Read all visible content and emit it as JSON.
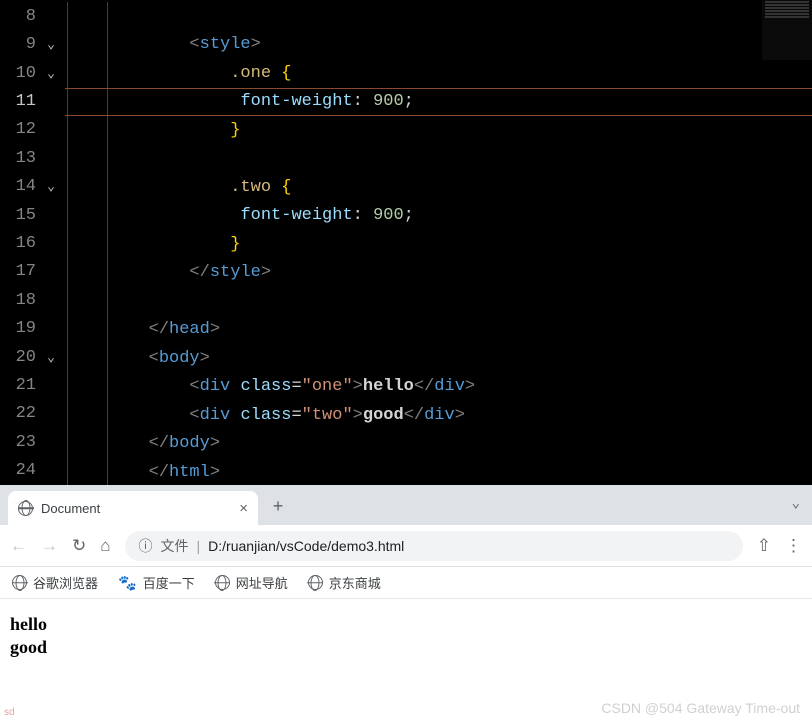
{
  "editor": {
    "highlighted_line": 11,
    "lines": [
      {
        "num": 8,
        "chevron": false,
        "indent": 0,
        "segments": []
      },
      {
        "num": 9,
        "chevron": true,
        "indent": 3,
        "segments": [
          {
            "cls": "tag-bracket",
            "t": "<"
          },
          {
            "cls": "tag-name",
            "t": "style"
          },
          {
            "cls": "tag-bracket",
            "t": ">"
          }
        ]
      },
      {
        "num": 10,
        "chevron": true,
        "indent": 4,
        "segments": [
          {
            "cls": "selector",
            "t": ".one"
          },
          {
            "cls": "",
            "t": " "
          },
          {
            "cls": "brace",
            "t": "{"
          }
        ]
      },
      {
        "num": 11,
        "chevron": false,
        "indent": 4,
        "segments": [
          {
            "cls": "",
            "t": " "
          },
          {
            "cls": "property",
            "t": "font-weight"
          },
          {
            "cls": "colon",
            "t": ": "
          },
          {
            "cls": "value-num",
            "t": "900"
          },
          {
            "cls": "semi",
            "t": ";"
          }
        ]
      },
      {
        "num": 12,
        "chevron": false,
        "indent": 4,
        "segments": [
          {
            "cls": "brace",
            "t": "}"
          }
        ]
      },
      {
        "num": 13,
        "chevron": false,
        "indent": 0,
        "segments": []
      },
      {
        "num": 14,
        "chevron": true,
        "indent": 4,
        "segments": [
          {
            "cls": "selector",
            "t": ".two"
          },
          {
            "cls": "",
            "t": " "
          },
          {
            "cls": "brace",
            "t": "{"
          }
        ]
      },
      {
        "num": 15,
        "chevron": false,
        "indent": 4,
        "segments": [
          {
            "cls": "",
            "t": " "
          },
          {
            "cls": "property",
            "t": "font-weight"
          },
          {
            "cls": "colon",
            "t": ": "
          },
          {
            "cls": "value-num",
            "t": "900"
          },
          {
            "cls": "semi",
            "t": ";"
          }
        ]
      },
      {
        "num": 16,
        "chevron": false,
        "indent": 4,
        "segments": [
          {
            "cls": "brace",
            "t": "}"
          }
        ]
      },
      {
        "num": 17,
        "chevron": false,
        "indent": 3,
        "segments": [
          {
            "cls": "tag-bracket",
            "t": "</"
          },
          {
            "cls": "tag-name",
            "t": "style"
          },
          {
            "cls": "tag-bracket",
            "t": ">"
          }
        ]
      },
      {
        "num": 18,
        "chevron": false,
        "indent": 0,
        "segments": []
      },
      {
        "num": 19,
        "chevron": false,
        "indent": 2,
        "segments": [
          {
            "cls": "tag-bracket",
            "t": "</"
          },
          {
            "cls": "tag-name",
            "t": "head"
          },
          {
            "cls": "tag-bracket",
            "t": ">"
          }
        ]
      },
      {
        "num": 20,
        "chevron": true,
        "indent": 2,
        "segments": [
          {
            "cls": "tag-bracket",
            "t": "<"
          },
          {
            "cls": "tag-name",
            "t": "body"
          },
          {
            "cls": "tag-bracket",
            "t": ">"
          }
        ]
      },
      {
        "num": 21,
        "chevron": false,
        "indent": 3,
        "segments": [
          {
            "cls": "tag-bracket",
            "t": "<"
          },
          {
            "cls": "tag-name",
            "t": "div"
          },
          {
            "cls": "",
            "t": " "
          },
          {
            "cls": "attr-name",
            "t": "class"
          },
          {
            "cls": "equals",
            "t": "="
          },
          {
            "cls": "string",
            "t": "\"one\""
          },
          {
            "cls": "tag-bracket",
            "t": ">"
          },
          {
            "cls": "text-content",
            "t": "hello"
          },
          {
            "cls": "tag-bracket",
            "t": "</"
          },
          {
            "cls": "tag-name",
            "t": "div"
          },
          {
            "cls": "tag-bracket",
            "t": ">"
          }
        ]
      },
      {
        "num": 22,
        "chevron": false,
        "indent": 3,
        "segments": [
          {
            "cls": "tag-bracket",
            "t": "<"
          },
          {
            "cls": "tag-name",
            "t": "div"
          },
          {
            "cls": "",
            "t": " "
          },
          {
            "cls": "attr-name",
            "t": "class"
          },
          {
            "cls": "equals",
            "t": "="
          },
          {
            "cls": "string",
            "t": "\"two\""
          },
          {
            "cls": "tag-bracket",
            "t": ">"
          },
          {
            "cls": "text-content",
            "t": "good"
          },
          {
            "cls": "tag-bracket",
            "t": "</"
          },
          {
            "cls": "tag-name",
            "t": "div"
          },
          {
            "cls": "tag-bracket",
            "t": ">"
          }
        ]
      },
      {
        "num": 23,
        "chevron": false,
        "indent": 2,
        "segments": [
          {
            "cls": "tag-bracket",
            "t": "</"
          },
          {
            "cls": "tag-name",
            "t": "body"
          },
          {
            "cls": "tag-bracket",
            "t": ">"
          }
        ]
      },
      {
        "num": 24,
        "chevron": false,
        "indent": 2,
        "segments": [
          {
            "cls": "tag-bracket",
            "t": "</"
          },
          {
            "cls": "tag-name",
            "t": "html"
          },
          {
            "cls": "tag-bracket",
            "t": ">"
          }
        ]
      }
    ]
  },
  "browser": {
    "tab_title": "Document",
    "address": {
      "label": "文件",
      "path": "D:/ruanjian/vsCode/demo3.html"
    },
    "bookmarks": [
      {
        "icon": "globe",
        "label": "谷歌浏览器"
      },
      {
        "icon": "paw",
        "label": "百度一下"
      },
      {
        "icon": "globe",
        "label": "网址导航"
      },
      {
        "icon": "globe",
        "label": "京东商城"
      }
    ],
    "page": {
      "line1": "hello",
      "line2": "good"
    }
  },
  "watermark": "CSDN @504 Gateway Time-out",
  "watermark_bl": "sd"
}
